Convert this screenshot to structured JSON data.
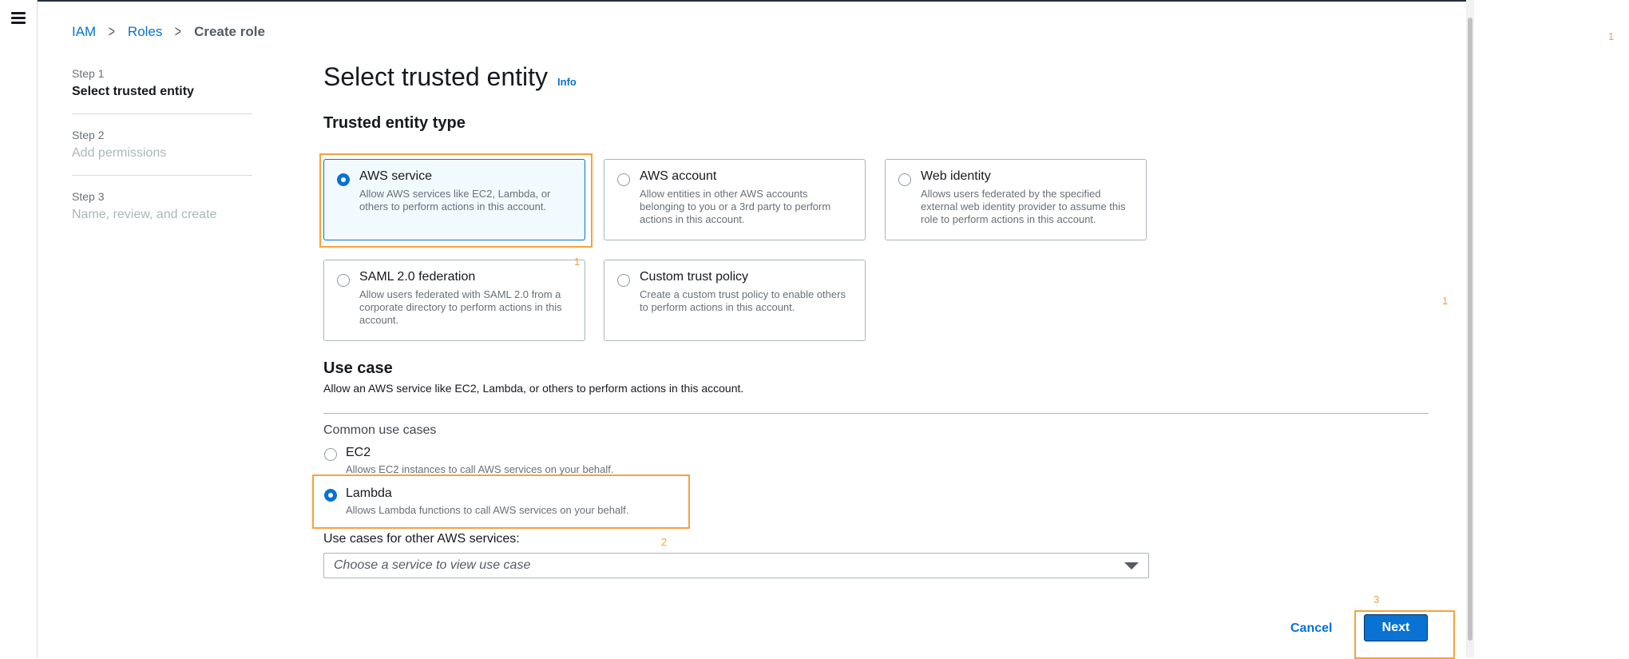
{
  "breadcrumb": {
    "items": [
      "IAM",
      "Roles"
    ],
    "current": "Create role"
  },
  "steps": [
    {
      "num": "Step 1",
      "title": "Select trusted entity"
    },
    {
      "num": "Step 2",
      "title": "Add permissions"
    },
    {
      "num": "Step 3",
      "title": "Name, review, and create"
    }
  ],
  "page": {
    "title": "Select trusted entity",
    "info": "Info"
  },
  "trusted_entity": {
    "heading": "Trusted entity type",
    "selected_index": 0,
    "tiles": [
      {
        "title": "AWS service",
        "desc": "Allow AWS services like EC2, Lambda, or others to perform actions in this account."
      },
      {
        "title": "AWS account",
        "desc": "Allow entities in other AWS accounts belonging to you or a 3rd party to perform actions in this account."
      },
      {
        "title": "Web identity",
        "desc": "Allows users federated by the specified external web identity provider to assume this role to perform actions in this account."
      },
      {
        "title": "SAML 2.0 federation",
        "desc": "Allow users federated with SAML 2.0 from a corporate directory to perform actions in this account."
      },
      {
        "title": "Custom trust policy",
        "desc": "Create a custom trust policy to enable others to perform actions in this account."
      }
    ]
  },
  "use_case": {
    "heading": "Use case",
    "subtitle": "Allow an AWS service like EC2, Lambda, or others to perform actions in this account.",
    "common_label": "Common use cases",
    "selected_index": 1,
    "options": [
      {
        "title": "EC2",
        "desc": "Allows EC2 instances to call AWS services on your behalf."
      },
      {
        "title": "Lambda",
        "desc": "Allows Lambda functions to call AWS services on your behalf."
      }
    ],
    "other_label": "Use cases for other AWS services:",
    "select_placeholder": "Choose a service to view use case"
  },
  "actions": {
    "cancel": "Cancel",
    "next": "Next"
  },
  "annotations": [
    "1",
    "1",
    "1",
    "2",
    "3"
  ],
  "colors": {
    "accent": "#0972d3",
    "highlight": "#f7a23b"
  }
}
